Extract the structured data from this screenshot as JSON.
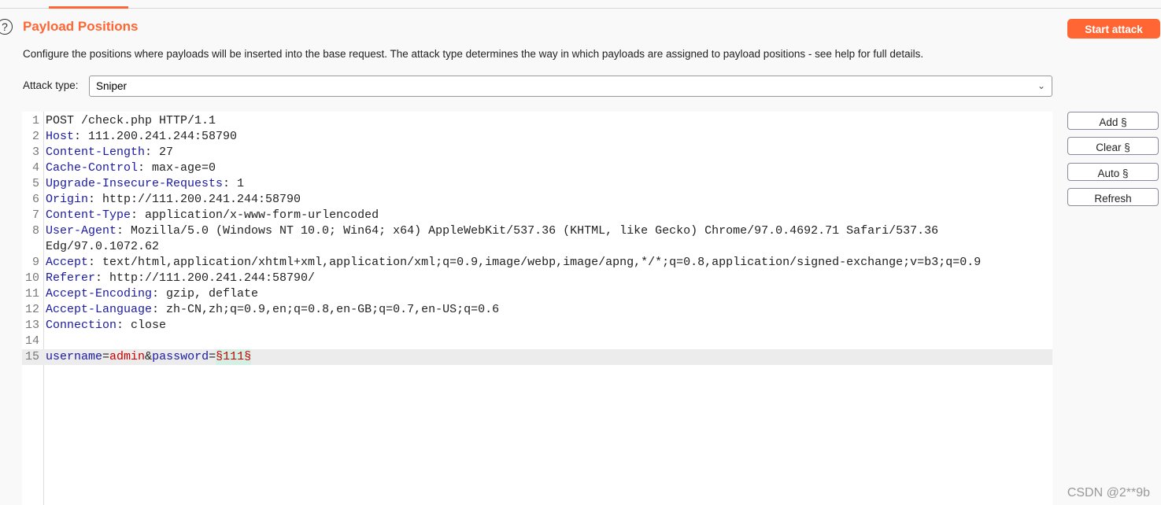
{
  "header": {
    "title": "Payload Positions",
    "description": "Configure the positions where payloads will be inserted into the base request. The attack type determines the way in which payloads are assigned to payload positions - see help for full details.",
    "start_label": "Start attack",
    "help_glyph": "?"
  },
  "attack_type": {
    "label": "Attack type:",
    "value": "Sniper"
  },
  "editor": {
    "lines": [
      {
        "n": "1",
        "k": "",
        "v": "POST /check.php HTTP/1.1"
      },
      {
        "n": "2",
        "k": "Host",
        "v": ": 111.200.241.244:58790"
      },
      {
        "n": "3",
        "k": "Content-Length",
        "v": ": 27"
      },
      {
        "n": "4",
        "k": "Cache-Control",
        "v": ": max-age=0"
      },
      {
        "n": "5",
        "k": "Upgrade-Insecure-Requests",
        "v": ": 1"
      },
      {
        "n": "6",
        "k": "Origin",
        "v": ": http://111.200.241.244:58790"
      },
      {
        "n": "7",
        "k": "Content-Type",
        "v": ": application/x-www-form-urlencoded"
      },
      {
        "n": "8",
        "k": "User-Agent",
        "v": ": Mozilla/5.0 (Windows NT 10.0; Win64; x64) AppleWebKit/537.36 (KHTML, like Gecko) Chrome/97.0.4692.71 Safari/537.36"
      },
      {
        "n": "",
        "k": "",
        "v": "Edg/97.0.1072.62"
      },
      {
        "n": "9",
        "k": "Accept",
        "v": ": text/html,application/xhtml+xml,application/xml;q=0.9,image/webp,image/apng,*/*;q=0.8,application/signed-exchange;v=b3;q=0.9"
      },
      {
        "n": "10",
        "k": "Referer",
        "v": ": http://111.200.241.244:58790/"
      },
      {
        "n": "11",
        "k": "Accept-Encoding",
        "v": ": gzip, deflate"
      },
      {
        "n": "12",
        "k": "Accept-Language",
        "v": ": zh-CN,zh;q=0.9,en;q=0.8,en-GB;q=0.7,en-US;q=0.6"
      },
      {
        "n": "13",
        "k": "Connection",
        "v": ": close"
      },
      {
        "n": "14",
        "k": "",
        "v": ""
      }
    ],
    "body": {
      "n": "15",
      "p1": "username",
      "eq1": "=",
      "v1": "admin",
      "amp": "&",
      "p2": "password",
      "eq2": "=",
      "payload": "§111§"
    }
  },
  "buttons": {
    "add": "Add §",
    "clear": "Clear §",
    "auto": "Auto §",
    "refresh": "Refresh"
  },
  "watermark": "CSDN @2**9b"
}
